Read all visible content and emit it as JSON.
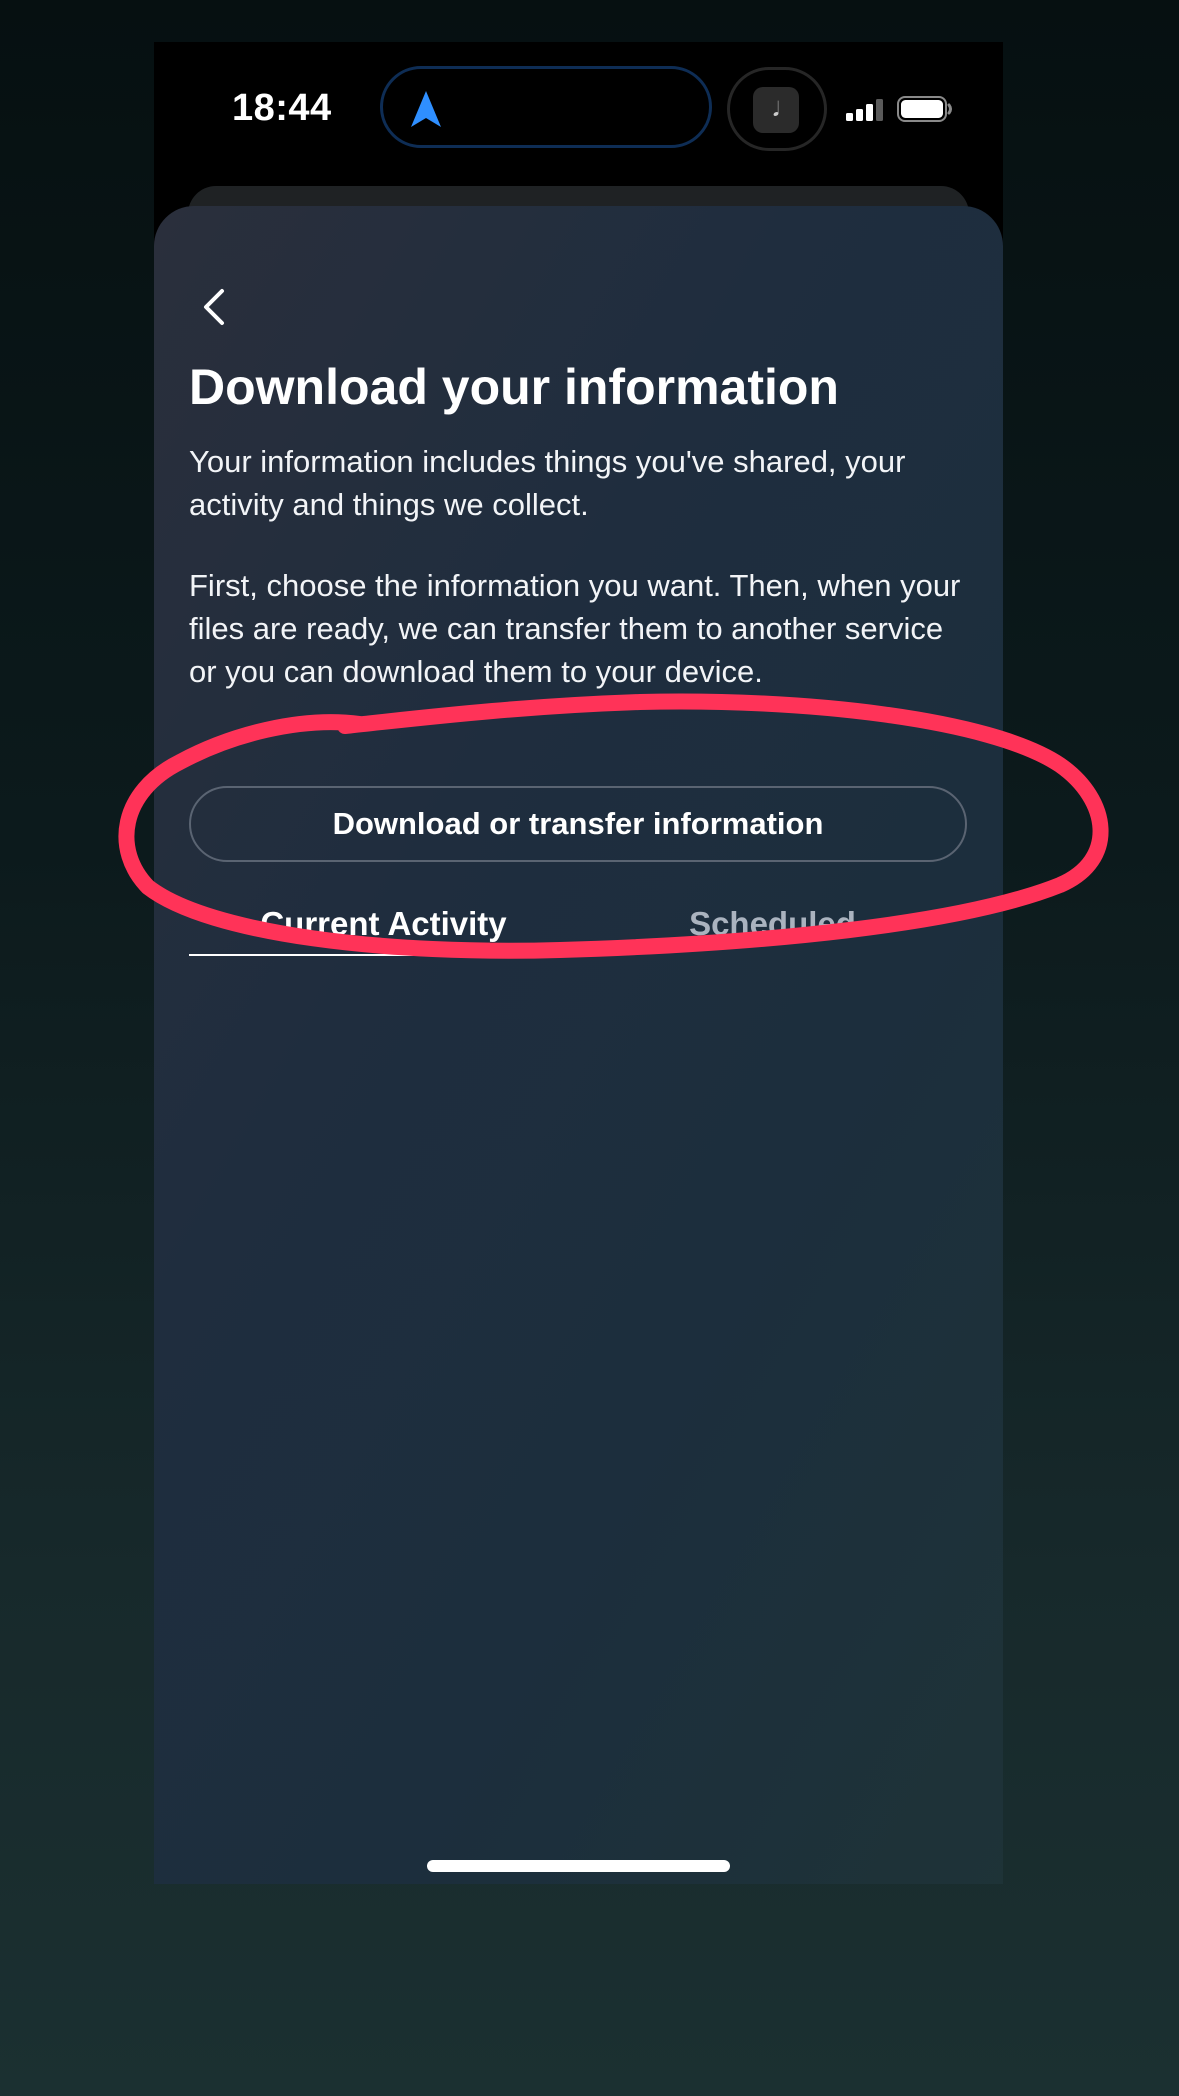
{
  "status_bar": {
    "time": "18:44",
    "live_activity_glyph": "𝅘𝅥"
  },
  "page": {
    "title": "Download your information",
    "paragraph1": "Your information includes things you've shared, your activity and things we collect.",
    "paragraph2": "First, choose the information you want. Then, when your files are ready, we can transfer them to another service or you can download them to your device.",
    "primary_button": "Download or transfer information",
    "tabs": [
      {
        "label": "Current Activity",
        "selected": true
      },
      {
        "label": "Scheduled",
        "selected": false
      }
    ]
  },
  "icons": {
    "back": "chevron-left-icon",
    "navigation": "navigation-arrow-icon",
    "signal": "cellular-signal-icon",
    "battery": "battery-icon"
  },
  "colors": {
    "navigation_arrow": "#2f8fff",
    "annotation_stroke": "#ff3358"
  }
}
